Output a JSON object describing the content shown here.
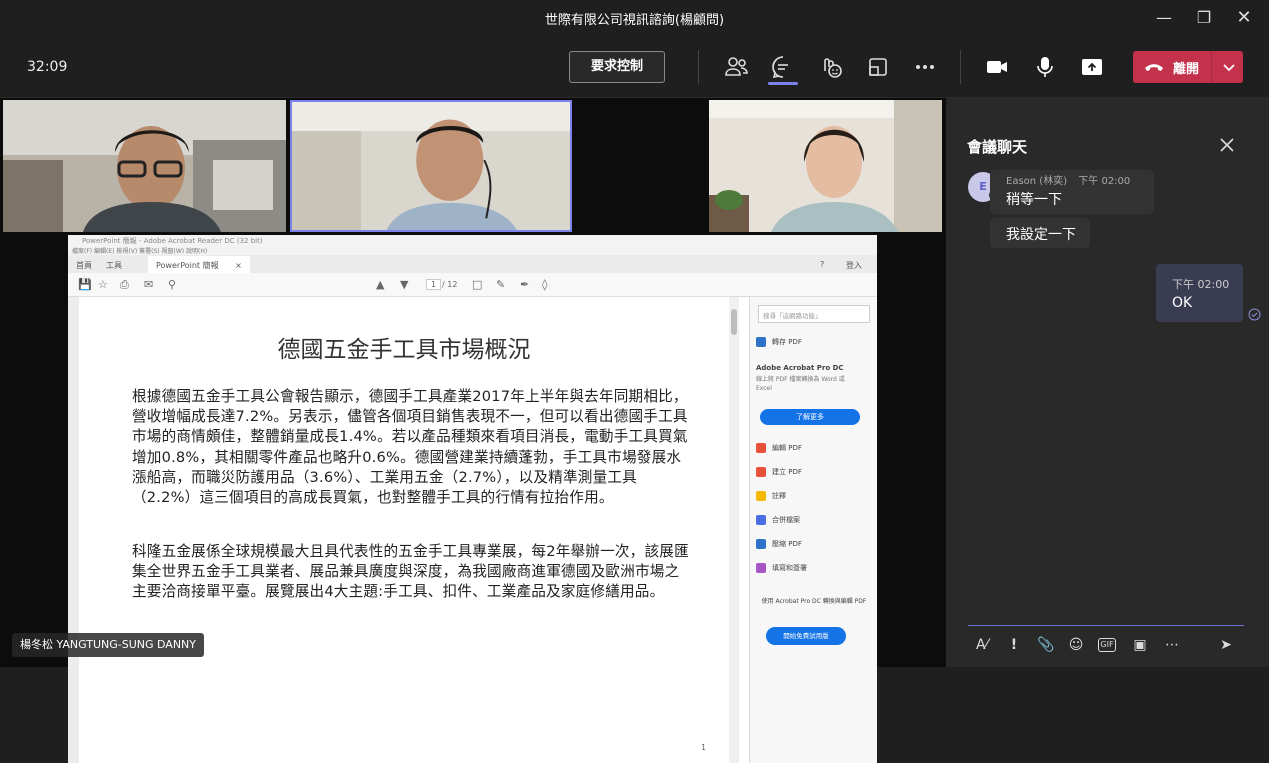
{
  "window": {
    "title": "世際有限公司視訊諮詢(楊顧問)"
  },
  "toolbar": {
    "timer": "32:09",
    "request_control_label": "要求控制",
    "leave_label": "離開"
  },
  "participants": [
    {
      "name": "楊冬松 YANGTUNG-SUNG DANNY"
    }
  ],
  "pdf": {
    "window_title": "PowerPoint 簡報 - Adobe Acrobat Reader DC (32 bit)",
    "menu": "檔案(F)  編輯(E)  檢視(V)  簽署(S)  視窗(W)  說明(H)",
    "tab_home": "首頁",
    "tab_tools": "工具",
    "tab_doc": "PowerPoint 簡報",
    "tab_close": "×",
    "sign_in": "登入",
    "page_current": "1",
    "page_total": "/ 12",
    "doc_title": "德國五金手工具市場概況",
    "para1": "根據德國五金手工具公會報告顯示，德國手工具產業2017年上半年與去年同期相比，營收增幅成長達7.2%。另表示，儘管各個項目銷售表現不一，但可以看出德國手工具市場的商情頗佳，整體銷量成長1.4%。若以產品種類來看項目消長，電動手工具買氣增加0.8%，其相關零件產品也略升0.6%。德國營建業持續蓬勃，手工具市場發展水漲船高，而職災防護用品（3.6%）、工業用五金（2.7%），以及精準測量工具（2.2%）這三個項目的高成長買氣，也對整體手工具的行情有拉抬作用。",
    "para2": "科隆五金展係全球規模最大且具代表性的五金手工具專業展，每2年舉辦一次，該展匯集全世界五金手工具業者、展品兼具廣度與深度，為我國廠商進軍德國及歐洲市場之主要洽商接單平臺。展覽展出4大主題:手工具、扣件、工業產品及家庭修繕用品。",
    "page_number": "1",
    "right_panel": {
      "search_placeholder": "搜尋「這網路功能」",
      "export_pdf": "轉存 PDF",
      "promo_title": "Adobe Acrobat Pro DC",
      "promo_text": "線上將 PDF 檔案轉換為 Word 或 Excel",
      "learn_more": "了解更多",
      "edit_pdf": "編輯 PDF",
      "create_pdf": "建立 PDF",
      "comment": "註釋",
      "combine": "合併檔案",
      "compress": "壓縮 PDF",
      "fill_sign": "填寫和簽署",
      "footer_text": "使用 Acrobat Pro DC 轉換與編輯 PDF",
      "trial_btn": "開始免費試用版"
    }
  },
  "chat": {
    "title": "會議聊天",
    "sender_name": "Eason (林奕)",
    "sender_time": "下午 02:00",
    "avatar_initial": "E",
    "messages": [
      {
        "text": "稍等一下"
      },
      {
        "text": "我設定一下"
      }
    ],
    "my_message": {
      "time": "下午 02:00",
      "text": "OK"
    }
  },
  "colors": {
    "accent": "#7b83eb",
    "leave": "#c4314b",
    "chat_bg": "#292929",
    "app_bg": "#1f1f1f"
  }
}
